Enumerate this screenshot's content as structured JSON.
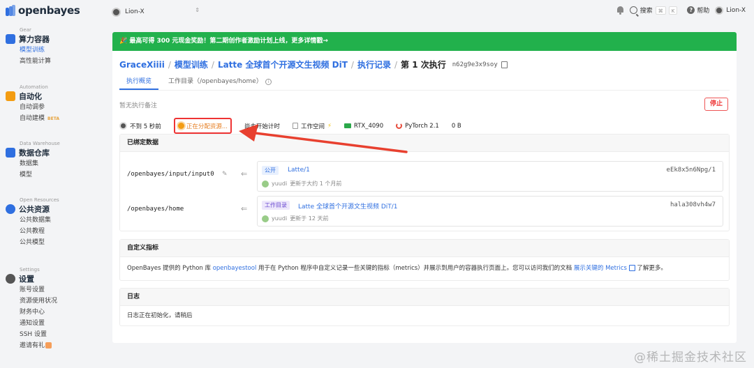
{
  "app": {
    "logo_text": "openbayes",
    "workspace_name": "Lion-X"
  },
  "topbar": {
    "search_label": "搜索",
    "search_kbd_1": "⌘",
    "search_kbd_2": "K",
    "help_label": "帮助",
    "user_name": "Lion-X"
  },
  "sidebar": {
    "sections": [
      {
        "small": "Gear",
        "title": "算力容器",
        "icon_color": "#2f6fe0",
        "items": [
          {
            "label": "模型训练",
            "active": true
          },
          {
            "label": "高性能计算"
          }
        ]
      },
      {
        "small": "Automation",
        "title": "自动化",
        "icon_color": "#f39c12",
        "items": [
          {
            "label": "自动调参"
          },
          {
            "label": "自动建模",
            "badge": "BETA"
          }
        ]
      },
      {
        "small": "Data Warehouse",
        "title": "数据仓库",
        "icon_color": "#2f6fe0",
        "items": [
          {
            "label": "数据集"
          },
          {
            "label": "模型"
          }
        ]
      },
      {
        "small": "Open Resources",
        "title": "公共资源",
        "icon_color": "#2f6fe0",
        "items": [
          {
            "label": "公共数据集"
          },
          {
            "label": "公共教程"
          },
          {
            "label": "公共模型"
          }
        ]
      },
      {
        "small": "Settings",
        "title": "设置",
        "icon_color": "#555555",
        "items": [
          {
            "label": "账号设置"
          },
          {
            "label": "资源使用状况"
          },
          {
            "label": "财务中心"
          },
          {
            "label": "通知设置"
          },
          {
            "label": "SSH 设置"
          },
          {
            "label": "邀请有礼"
          }
        ]
      }
    ]
  },
  "banner": {
    "text": "🎉 最高可得 300 元现金奖励！第二期创作者激励计划上线，更多详情戳→"
  },
  "breadcrumb": {
    "user": "GraceXiiii",
    "project": "模型训练",
    "job": "Latte 全球首个开源文生视频 DiT",
    "records": "执行记录",
    "current": "第 1 次执行",
    "exec_id": "n62g9e3x9soy"
  },
  "tabs": {
    "overview": "执行概览",
    "workdir": "工作目录（/openbayes/home）"
  },
  "exec": {
    "remark": "暂无执行备注",
    "stop_label": "停止",
    "time_ago": "不到 5 秒前",
    "status": "正在分配资源...",
    "timer": "尚未开始计时",
    "workspace": "工作空间",
    "gpu": "RTX_4090",
    "framework": "PyTorch 2.1",
    "size": "0 B"
  },
  "bound_data": {
    "heading": "已绑定数据",
    "rows": [
      {
        "path": "/openbayes/input/input0",
        "tag": "公开",
        "name": "Latte/1",
        "hash": "eEk8x5n6Npg/1",
        "user": "yuudi",
        "updated": "更新于大约 1 个月前"
      },
      {
        "path": "/openbayes/home",
        "tag": "工作目录",
        "name": "Latte 全球首个开源文生视频 DiT/1",
        "hash": "hala308vh4w7",
        "user": "yuudi",
        "updated": "更新于 12 天前"
      }
    ]
  },
  "metrics": {
    "heading": "自定义指标",
    "text_a": "OpenBayes 提供的 Python 库 ",
    "link_a": "openbayestool",
    "text_b": " 用于在 Python 程序中自定义记录一些关键的指标（metrics）并展示到用户的容器执行页面上。您可以访问我们的文档 ",
    "link_b": "展示关键的 Metrics",
    "text_c": " 了解更多。"
  },
  "log": {
    "heading": "日志",
    "text": "日志正在初始化，请稍后"
  },
  "watermark": "@稀土掘金技术社区",
  "colors": {
    "accent": "#2f6fe0",
    "banner": "#22b14c",
    "danger": "#e33333",
    "status": "#e67e22"
  }
}
